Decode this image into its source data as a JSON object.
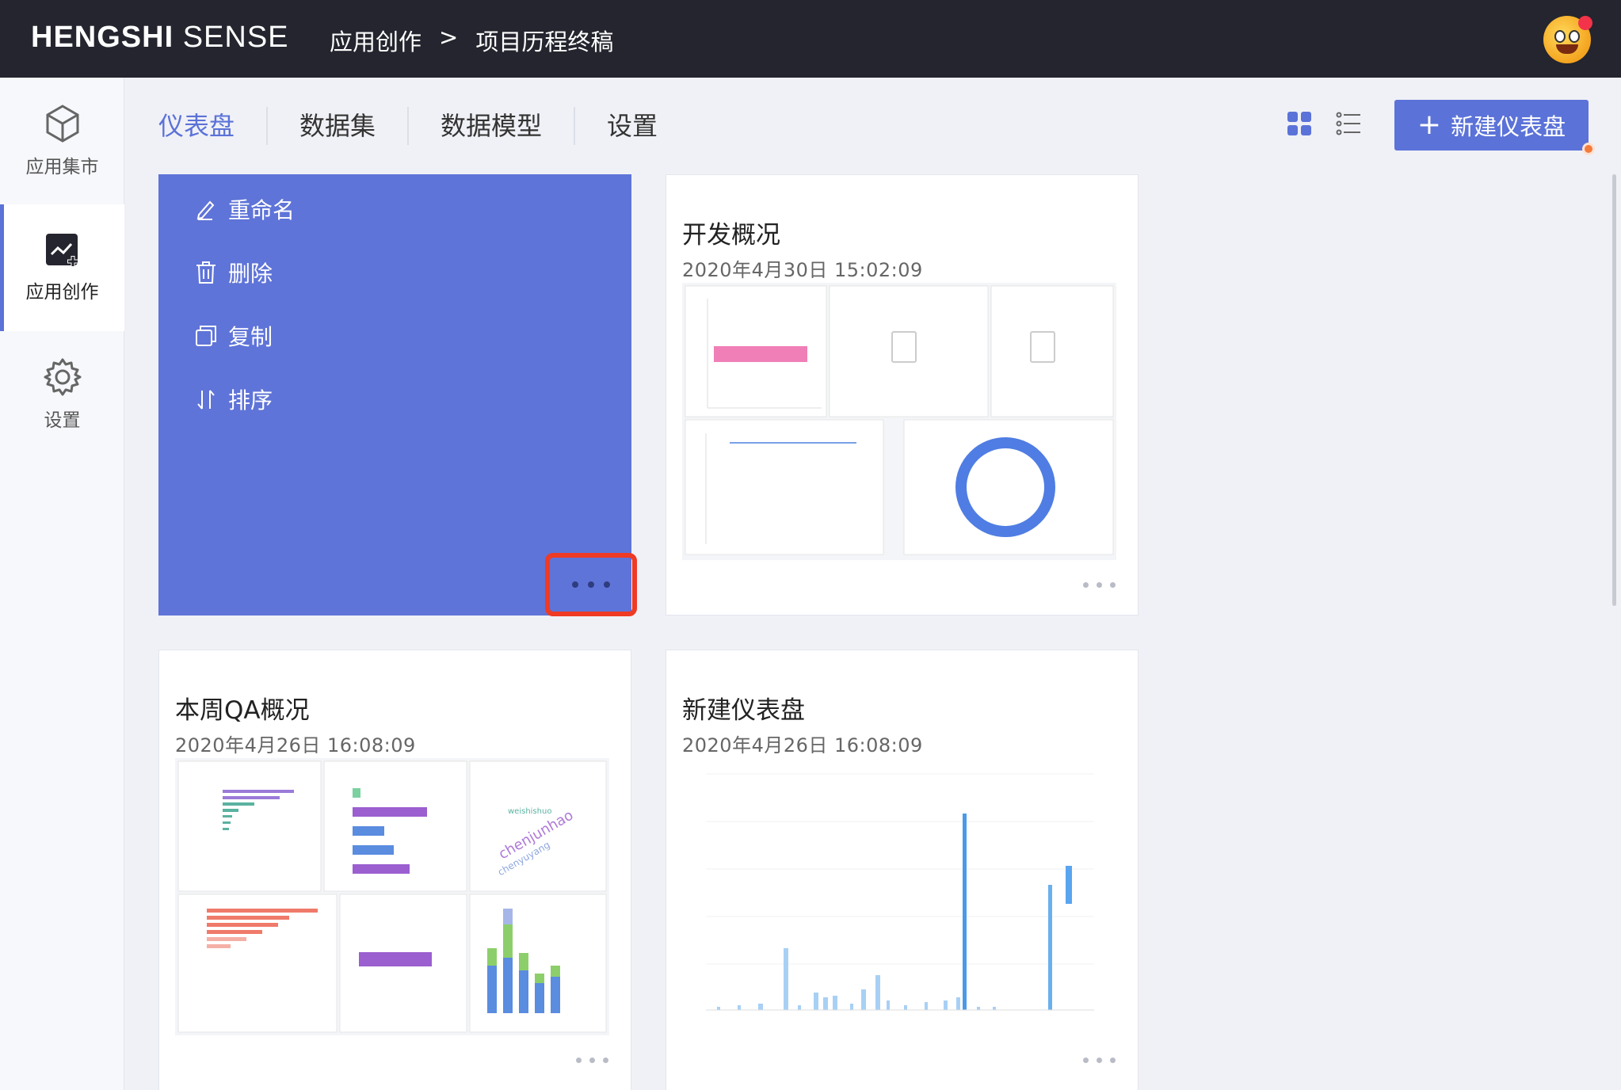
{
  "app": {
    "logo_bold": "HENGSHI",
    "logo_light": "SENSE"
  },
  "breadcrumb": {
    "root": "应用创作",
    "separator": ">",
    "current": "项目历程终稿"
  },
  "sidebar": {
    "items": [
      {
        "label": "应用集市",
        "icon": "cube-icon"
      },
      {
        "label": "应用创作",
        "icon": "chart-add-icon",
        "active": true
      },
      {
        "label": "设置",
        "icon": "gear-icon"
      }
    ]
  },
  "tabs": [
    {
      "label": "仪表盘",
      "active": true
    },
    {
      "label": "数据集"
    },
    {
      "label": "数据模型"
    },
    {
      "label": "设置"
    }
  ],
  "toolbar": {
    "new_button": "新建仪表盘",
    "grid_view_icon": "grid-view-icon",
    "list_view_icon": "list-view-icon"
  },
  "context_menu": {
    "items": [
      {
        "label": "重命名",
        "icon": "pencil-icon"
      },
      {
        "label": "删除",
        "icon": "trash-icon"
      },
      {
        "label": "复制",
        "icon": "copy-icon"
      },
      {
        "label": "排序",
        "icon": "sort-icon"
      }
    ]
  },
  "cards": [
    {
      "title": "开发概况",
      "date": "2020年4月30日 15:02:09"
    },
    {
      "title": "本周QA概况",
      "date": "2020年4月26日 16:08:09"
    },
    {
      "title": "新建仪表盘",
      "date": "2020年4月26日 16:08:09"
    }
  ],
  "colors": {
    "accent": "#5b72d8",
    "topbar": "#24252e",
    "highlight": "#ef3a24"
  }
}
